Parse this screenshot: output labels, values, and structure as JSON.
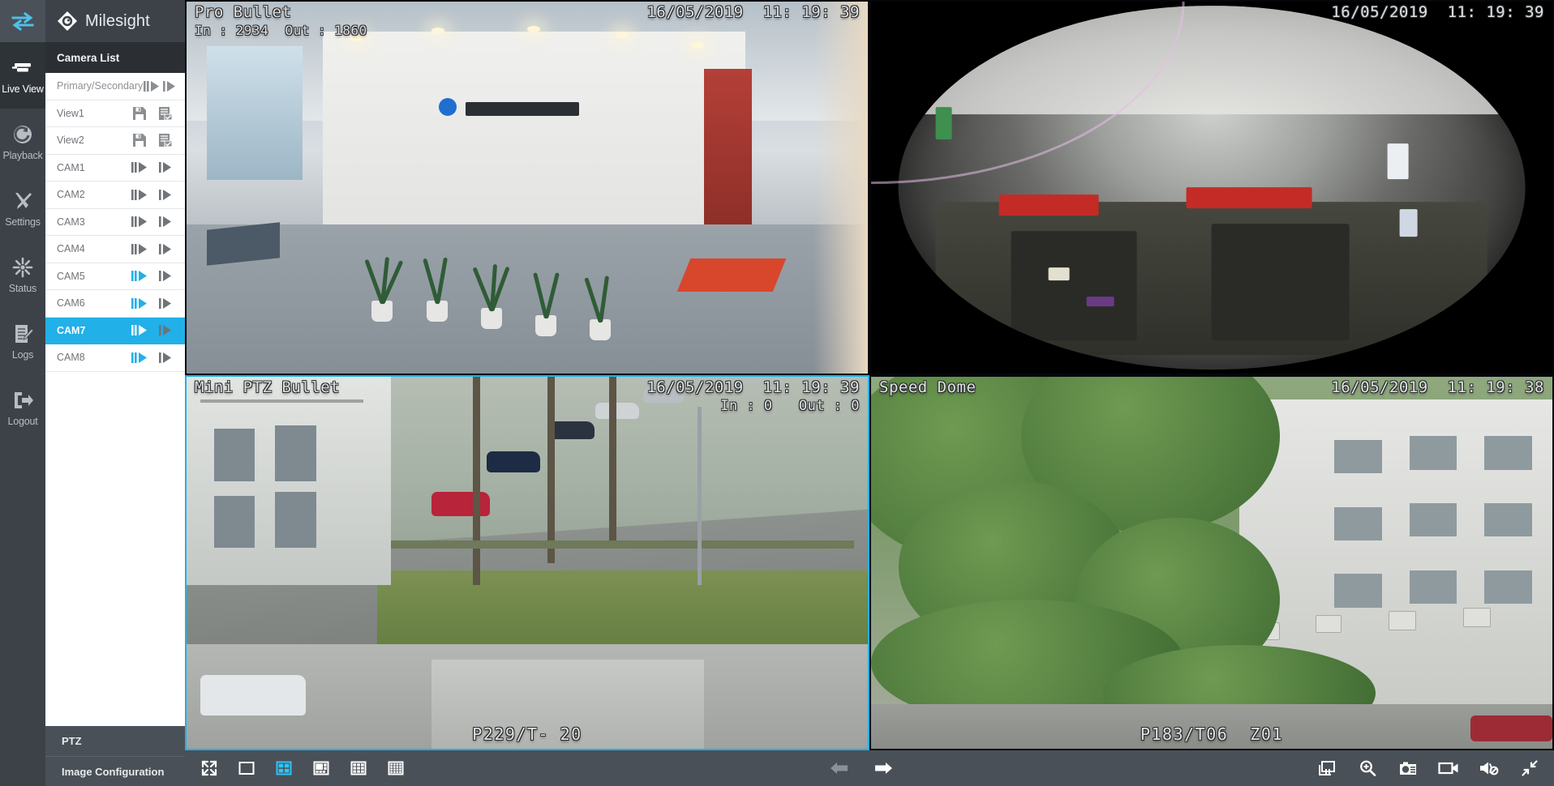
{
  "brand": {
    "name": "Milesight",
    "logo_icon": "milesight-diamond-logo"
  },
  "nav_rail": {
    "toggle_icon": "collapse-toggle-icon",
    "items": [
      {
        "label": "Live View",
        "icon": "live-view-icon",
        "active": true
      },
      {
        "label": "Playback",
        "icon": "playback-icon",
        "active": false
      },
      {
        "label": "Settings",
        "icon": "settings-tools-icon",
        "active": false
      },
      {
        "label": "Status",
        "icon": "status-burst-icon",
        "active": false
      },
      {
        "label": "Logs",
        "icon": "logs-notepad-icon",
        "active": false
      },
      {
        "label": "Logout",
        "icon": "logout-arrow-icon",
        "active": false
      }
    ]
  },
  "camera_panel": {
    "header": "Camera List",
    "rows": [
      {
        "label": "Primary/Secondary",
        "type": "stream-header",
        "icon_left": "primary-stream-icon",
        "icon_right": "secondary-stream-icon",
        "left_active": false,
        "selected": false
      },
      {
        "label": "View1",
        "type": "view",
        "icon_left": "save-view-icon",
        "icon_right": "apply-view-icon",
        "left_active": false,
        "selected": false
      },
      {
        "label": "View2",
        "type": "view",
        "icon_left": "save-view-icon",
        "icon_right": "apply-view-icon",
        "left_active": false,
        "selected": false
      },
      {
        "label": "CAM1",
        "type": "camera",
        "icon_left": "primary-stream-icon",
        "icon_right": "secondary-stream-icon",
        "left_active": false,
        "selected": false
      },
      {
        "label": "CAM2",
        "type": "camera",
        "icon_left": "primary-stream-icon",
        "icon_right": "secondary-stream-icon",
        "left_active": false,
        "selected": false
      },
      {
        "label": "CAM3",
        "type": "camera",
        "icon_left": "primary-stream-icon",
        "icon_right": "secondary-stream-icon",
        "left_active": false,
        "selected": false
      },
      {
        "label": "CAM4",
        "type": "camera",
        "icon_left": "primary-stream-icon",
        "icon_right": "secondary-stream-icon",
        "left_active": false,
        "selected": false
      },
      {
        "label": "CAM5",
        "type": "camera",
        "icon_left": "primary-stream-icon",
        "icon_right": "secondary-stream-icon",
        "left_active": true,
        "selected": false
      },
      {
        "label": "CAM6",
        "type": "camera",
        "icon_left": "primary-stream-icon",
        "icon_right": "secondary-stream-icon",
        "left_active": true,
        "selected": false
      },
      {
        "label": "CAM7",
        "type": "camera",
        "icon_left": "primary-stream-icon",
        "icon_right": "secondary-stream-icon",
        "left_active": false,
        "selected": true
      },
      {
        "label": "CAM8",
        "type": "camera",
        "icon_left": "primary-stream-icon",
        "icon_right": "secondary-stream-icon",
        "left_active": true,
        "selected": false
      }
    ],
    "footer": [
      {
        "label": "PTZ"
      },
      {
        "label": "Image Configuration"
      }
    ]
  },
  "panes": [
    {
      "title": "Pro Bullet",
      "counter": "In : 2934  Out : 1860",
      "timestamp": "16/05/2019  11: 19: 39",
      "ptz": "",
      "selected": false
    },
    {
      "title": "",
      "counter": "",
      "timestamp": "16/05/2019  11: 19: 39",
      "ptz": "",
      "selected": false
    },
    {
      "title": "Mini PTZ Bullet",
      "counter": "In : 0   Out : 0",
      "timestamp": "16/05/2019  11: 19: 39",
      "ptz": "P229/T- 20",
      "selected": true
    },
    {
      "title": "Speed Dome",
      "counter": "",
      "timestamp": "16/05/2019  11: 19: 38",
      "ptz": "P183/T06  Z01",
      "selected": false
    }
  ],
  "toolbar": {
    "layouts": [
      {
        "name": "fullscreen-layout-icon",
        "label": "Full Screen",
        "active": false
      },
      {
        "name": "layout-1x1-icon",
        "label": "1 Division",
        "active": false
      },
      {
        "name": "layout-2x2-icon",
        "label": "4 Divisions",
        "active": true
      },
      {
        "name": "layout-1plus5-icon",
        "label": "6 Divisions",
        "active": false
      },
      {
        "name": "layout-3x3-icon",
        "label": "9 Divisions",
        "active": false
      },
      {
        "name": "layout-4x4-icon",
        "label": "16 Divisions",
        "active": false
      }
    ],
    "pager": [
      {
        "name": "previous-page-icon",
        "label": "Previous",
        "enabled": false
      },
      {
        "name": "next-page-icon",
        "label": "Next",
        "enabled": true
      }
    ],
    "actions": [
      {
        "name": "pause-all-icon",
        "label": "Pause All"
      },
      {
        "name": "digital-zoom-icon",
        "label": "Digital Zoom"
      },
      {
        "name": "snapshot-icon",
        "label": "Snapshot"
      },
      {
        "name": "record-icon",
        "label": "Record"
      },
      {
        "name": "audio-mute-icon",
        "label": "Audio Off"
      },
      {
        "name": "exit-fullscreen-icon",
        "label": "Exit Full Screen"
      }
    ]
  },
  "colors": {
    "accent": "#22b0e8",
    "panel_bg": "#4a5057",
    "rail_bg": "#3c4248",
    "list_header_bg": "#2b2f33",
    "active_nav_bg": "#2e3338"
  }
}
